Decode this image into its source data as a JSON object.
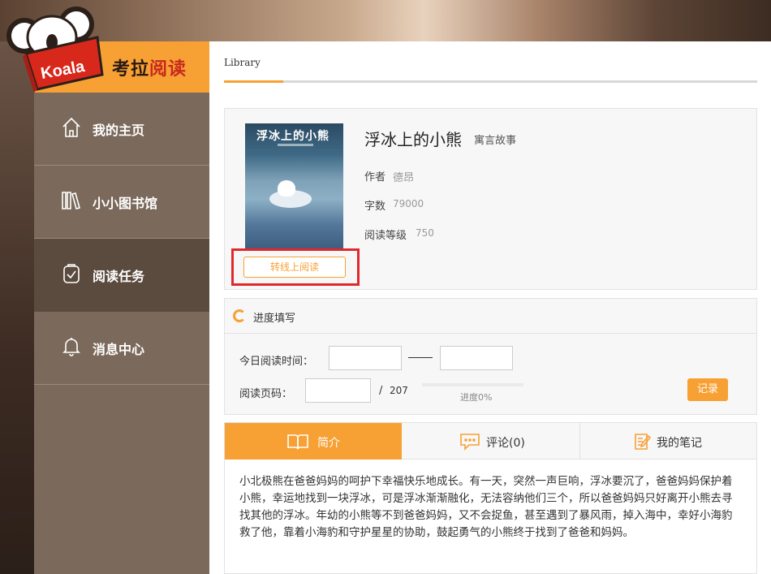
{
  "brand": {
    "logo_badge": "Koala",
    "name_part1": "考拉",
    "name_part2": "阅读"
  },
  "sidebar": {
    "items": [
      {
        "label": "我的主页",
        "icon": "home-icon"
      },
      {
        "label": "小小图书馆",
        "icon": "books-icon"
      },
      {
        "label": "阅读任务",
        "icon": "task-icon",
        "active": true
      },
      {
        "label": "消息中心",
        "icon": "bell-icon"
      }
    ]
  },
  "main": {
    "tab_label": "Library",
    "book": {
      "cover_title": "浮冰上的小熊",
      "title": "浮冰上的小熊",
      "category": "寓言故事",
      "author_label": "作者",
      "author": "德昂",
      "words_label": "字数",
      "words": "79000",
      "level_label": "阅读等级",
      "level": "750",
      "read_online": "转线上阅读"
    },
    "progress": {
      "title": "进度填写",
      "time_label": "今日阅读时间：",
      "time_start": "",
      "time_end": "",
      "page_label": "阅读页码：",
      "page_value": "",
      "slash": "/",
      "total_pages": "207",
      "progress_text": "进度0%",
      "progress_fraction": 0,
      "record_button": "记录"
    },
    "tabs": [
      {
        "label": "简介",
        "icon": "open-book-icon",
        "active": true
      },
      {
        "label": "评论(0)",
        "icon": "comment-icon"
      },
      {
        "label": "我的笔记",
        "icon": "note-icon"
      }
    ],
    "intro": "小北极熊在爸爸妈妈的呵护下幸福快乐地成长。有一天，突然一声巨响，浮冰要沉了，爸爸妈妈保护着小熊，幸运地找到一块浮冰，可是浮冰渐渐融化，无法容纳他们三个，所以爸爸妈妈只好离开小熊去寻找其他的浮冰。年幼的小熊等不到爸爸妈妈，又不会捉鱼，甚至遇到了暴风雨，掉入海中，幸好小海豹救了他，靠着小海豹和守护星星的协助，鼓起勇气的小熊终于找到了爸爸和妈妈。"
  },
  "colors": {
    "accent": "#f7a135",
    "sidebar": "#7b6a5c",
    "sidebar_active": "#5b4b3f",
    "highlight_box": "#e2272c"
  }
}
